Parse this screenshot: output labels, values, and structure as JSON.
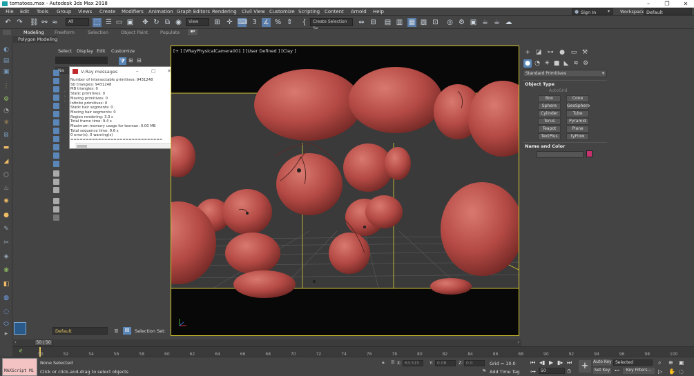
{
  "window": {
    "title": "tomatoes.max - Autodesk 3ds Max 2018",
    "minimize": "–",
    "maximize": "❐",
    "close": "✕"
  },
  "menu": [
    "File",
    "Edit",
    "Tools",
    "Group",
    "Views",
    "Create",
    "Modifiers",
    "Animation",
    "Graph Editors",
    "Rendering",
    "Civil View",
    "Customize",
    "Scripting",
    "Content",
    "Arnold",
    "Help"
  ],
  "account": {
    "sign_in": "Sign In",
    "workspaces_label": "Workspaces:",
    "workspace_value": "Default"
  },
  "toolbar": {
    "selection_filter": "All",
    "ref_coord": "View",
    "named_selection": "Create Selection Se"
  },
  "ribbon": {
    "tabs": [
      "Modeling",
      "Freeform",
      "Selection",
      "Object Paint",
      "Populate"
    ],
    "sub": "Polygon Modeling"
  },
  "explorer": {
    "menu": [
      "Select",
      "Display",
      "Edit",
      "Customize"
    ],
    "header": "Na"
  },
  "vray": {
    "title": "V-Ray messages",
    "lines": [
      "Number of intersectable primitives: 9431248",
      "  SD triangles: 9431248",
      "  MB triangles: 0",
      "  Static primitives: 0",
      "  Moving primitives: 0",
      "  Infinite primitives: 0",
      "  Static hair segments: 0",
      "  Moving hair segments: 0",
      "Region rendering: 3.3 s",
      "Total frame time: 9.4 s",
      "Maximum memory usage for texman: 0.00 MB",
      "Total sequence time: 9.6 s",
      "0 error(s), 0 warning(s)",
      "=============================="
    ]
  },
  "viewport": {
    "label": "[+ ] [VRayPhysicalCamera001 ] [User Defined ] [Clay ]"
  },
  "command_panel": {
    "dropdown": "Standard Primitives",
    "object_type_header": "Object Type",
    "autogrid": "AutoGrid",
    "buttons": [
      "Box",
      "Cone",
      "Sphere",
      "GeoSphere",
      "Cylinder",
      "Tube",
      "Torus",
      "Pyramid",
      "Teapot",
      "Plane",
      "TextPlus",
      "tyFlow"
    ],
    "name_color_header": "Name and Color",
    "object_color": "#c8326f"
  },
  "layer": {
    "name": "Default",
    "selection_set": "Selection Set:"
  },
  "timeline": {
    "slider": "50 / 50",
    "ticks": [
      "50",
      "52",
      "54",
      "56",
      "58",
      "60",
      "62",
      "64",
      "66",
      "68",
      "70",
      "72",
      "74",
      "76",
      "78",
      "80",
      "82",
      "84",
      "86",
      "88",
      "90",
      "92",
      "94",
      "96",
      "98",
      "100"
    ]
  },
  "status": {
    "maxscript": "MAXScript Mi",
    "selection": "None Selected",
    "prompt": "Click or click-and-drag to select objects",
    "x_label": "X:",
    "x_value": "63.515",
    "y_label": "Y:",
    "y_value": "0.08",
    "z_label": "Z:",
    "z_value": "0.0",
    "grid": "Grid = 10.0",
    "add_time_tag": "Add Time Tag",
    "auto_key": "Auto Key",
    "selected": "Selected",
    "set_key": "Set Key",
    "key_filters": "Key Filters...",
    "frame": "50"
  },
  "colors": {
    "tomato": "#b54a45",
    "viewport_border": "#d8c82c",
    "vray_icon": "#c02a2a"
  }
}
